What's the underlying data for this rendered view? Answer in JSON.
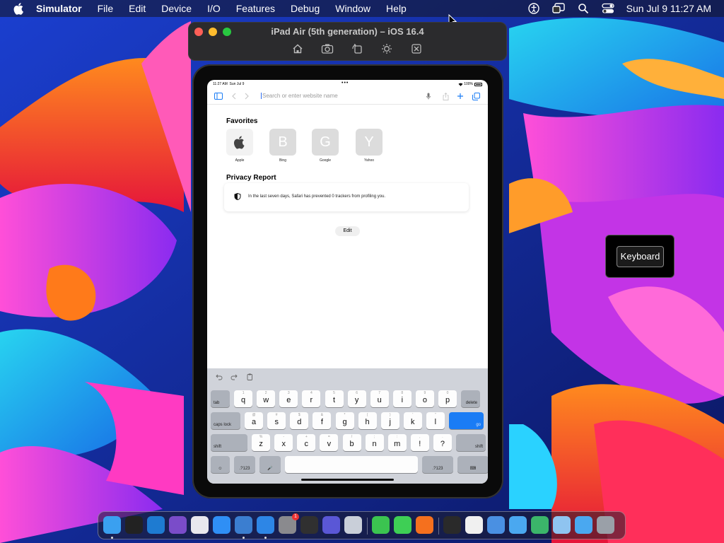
{
  "menubar": {
    "app_name": "Simulator",
    "menus": [
      "File",
      "Edit",
      "Device",
      "I/O",
      "Features",
      "Debug",
      "Window",
      "Help"
    ],
    "clock": "Sun Jul 9  11:27 AM",
    "status_icons": [
      "accessibility-icon",
      "screen-mirroring-icon",
      "spotlight-search-icon",
      "control-center-icon"
    ]
  },
  "simulator": {
    "title": "iPad Air (5th generation) – iOS 16.4",
    "tools": [
      "home-icon",
      "screenshot-icon",
      "rotate-icon",
      "appearance-icon",
      "close-keyboard-icon"
    ]
  },
  "ipad": {
    "status": {
      "time": "11:27 AM",
      "date": "Sun Jul 9",
      "dots": "•••",
      "battery": "100%"
    },
    "safari": {
      "url_placeholder": "Search or enter website name",
      "favorites_heading": "Favorites",
      "favorites": [
        {
          "letter": "",
          "label": "Apple"
        },
        {
          "letter": "B",
          "label": "Bing"
        },
        {
          "letter": "G",
          "label": "Google"
        },
        {
          "letter": "Y",
          "label": "Yahoo"
        }
      ],
      "privacy_heading": "Privacy Report",
      "privacy_text": "In the last seven days, Safari has prevented 0 trackers from profiling you.",
      "edit_label": "Edit"
    },
    "keyboard": {
      "row1": [
        {
          "k": "tab",
          "t": "fn"
        },
        {
          "k": "q",
          "s": "1"
        },
        {
          "k": "w",
          "s": "2"
        },
        {
          "k": "e",
          "s": "3"
        },
        {
          "k": "r",
          "s": "4"
        },
        {
          "k": "t",
          "s": "5"
        },
        {
          "k": "y",
          "s": "6"
        },
        {
          "k": "u",
          "s": "7"
        },
        {
          "k": "i",
          "s": "8"
        },
        {
          "k": "o",
          "s": "9"
        },
        {
          "k": "p",
          "s": "0"
        },
        {
          "k": "delete",
          "t": "fnr"
        }
      ],
      "row2": [
        {
          "k": "caps lock",
          "t": "fn"
        },
        {
          "k": "a",
          "s": "@"
        },
        {
          "k": "s",
          "s": "#"
        },
        {
          "k": "d",
          "s": "$"
        },
        {
          "k": "f",
          "s": "&"
        },
        {
          "k": "g",
          "s": "*"
        },
        {
          "k": "h",
          "s": "("
        },
        {
          "k": "j",
          "s": ")"
        },
        {
          "k": "k",
          "s": "'"
        },
        {
          "k": "l",
          "s": "\""
        },
        {
          "k": "go",
          "t": "go"
        }
      ],
      "row3": [
        {
          "k": "shift",
          "t": "fn"
        },
        {
          "k": "z",
          "s": "%"
        },
        {
          "k": "x",
          "s": "-"
        },
        {
          "k": "c",
          "s": "+"
        },
        {
          "k": "v",
          "s": "="
        },
        {
          "k": "b",
          "s": "/"
        },
        {
          "k": "n",
          "s": ";"
        },
        {
          "k": "m",
          "s": ":"
        },
        {
          "k": "!",
          "s": ","
        },
        {
          "k": "?",
          "s": "."
        },
        {
          "k": "shift",
          "t": "fnr"
        }
      ],
      "row4": [
        {
          "k": "☺",
          "t": "fnc"
        },
        {
          "k": ".?123",
          "t": "fnc"
        },
        {
          "k": "🎤",
          "t": "fnc"
        },
        {
          "k": "",
          "t": "space"
        },
        {
          "k": ".?123",
          "t": "fnc"
        },
        {
          "k": "⌨",
          "t": "fnc"
        }
      ]
    }
  },
  "keyboard_popup": {
    "label": "Keyboard"
  },
  "dock": {
    "apps": [
      {
        "name": "finder-icon",
        "color": "#3aa0f0",
        "dot": true
      },
      {
        "name": "terminal-icon",
        "color": "#222222",
        "dot": false
      },
      {
        "name": "vscode-icon",
        "color": "#1e7bd1",
        "dot": false
      },
      {
        "name": "visual-studio-icon",
        "color": "#7a4cc9",
        "dot": false
      },
      {
        "name": "bbedit-icon",
        "color": "#e8e8ee",
        "dot": false
      },
      {
        "name": "app-store-icon",
        "color": "#2f8ff5",
        "dot": false
      },
      {
        "name": "xcode-icon",
        "color": "#3b7ed0",
        "dot": true
      },
      {
        "name": "simulator-icon",
        "color": "#2d86e6",
        "dot": true
      },
      {
        "name": "system-settings-icon",
        "color": "#8a8a8e",
        "dot": false,
        "badge": "1"
      },
      {
        "name": "console-icon",
        "color": "#303030",
        "dot": false
      },
      {
        "name": "shortcuts-icon",
        "color": "#5a57d6",
        "dot": false
      },
      {
        "name": "launchpad-icon",
        "color": "#c9cfd9",
        "dot": false
      },
      {
        "name": "facetime-icon",
        "color": "#3bc450",
        "dot": false
      },
      {
        "name": "messages-icon",
        "color": "#3ecf55",
        "dot": false
      },
      {
        "name": "firefox-icon",
        "color": "#f5701e",
        "dot": false
      },
      {
        "name": "activity-monitor-icon",
        "color": "#2a2a2a",
        "dot": false
      },
      {
        "name": "document-icon",
        "color": "#f0f0f0",
        "dot": false
      },
      {
        "name": "network-utility-icon",
        "color": "#4a90e2",
        "dot": false
      },
      {
        "name": "folder-icon",
        "color": "#4aa8f0",
        "dot": false
      },
      {
        "name": "keka-icon",
        "color": "#3bb56a",
        "dot": false
      },
      {
        "name": "folder-icon",
        "color": "#8fc4f0",
        "dot": false
      },
      {
        "name": "folder-icon",
        "color": "#4aa8f0",
        "dot": false
      },
      {
        "name": "trash-icon",
        "color": "#9aa0a8",
        "dot": false
      }
    ]
  },
  "colors": {
    "accent": "#1a7cf5",
    "keyboard_bg": "#d0d3da"
  }
}
